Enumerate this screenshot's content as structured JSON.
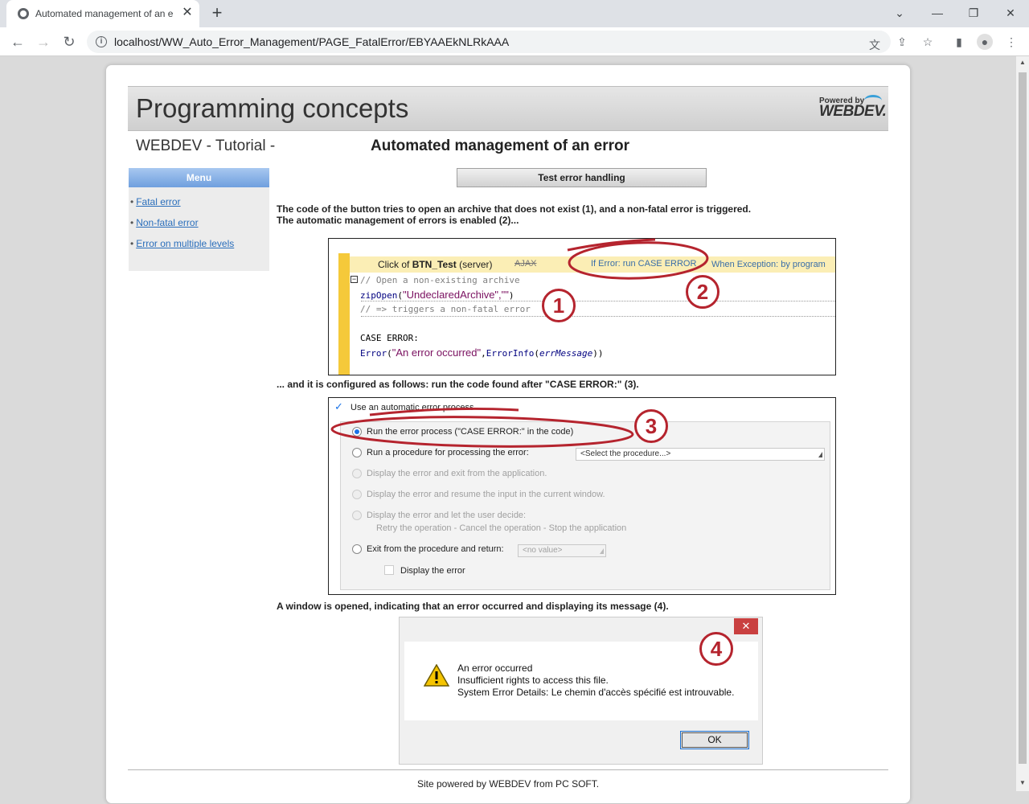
{
  "browser": {
    "tab_title": "Automated management of an e",
    "tab_close": "✕",
    "new_tab": "+",
    "url": "localhost/WW_Auto_Error_Management/PAGE_FatalError/EBYAAEkNLRkAAA",
    "win_controls": [
      "⌄",
      "—",
      "❐",
      "✕"
    ],
    "nav": {
      "back": "←",
      "forward": "→",
      "reload": "↻"
    },
    "toolbar_icons": [
      "translate-icon",
      "share-icon",
      "star-icon",
      "sidebar-icon",
      "profile-icon",
      "menu-icon"
    ]
  },
  "header": {
    "title": "Programming concepts",
    "logo_small": "Powered by",
    "logo_big": "WEBDEV."
  },
  "subtitle": "WEBDEV - Tutorial -",
  "heading": "Automated management of an error",
  "menu": {
    "title": "Menu",
    "items": [
      {
        "bullet": "•",
        "label": "Fatal error"
      },
      {
        "bullet": "•",
        "label": "Non-fatal error"
      },
      {
        "bullet": "•",
        "label": "Error on multiple levels"
      }
    ]
  },
  "test_button": "Test error handling",
  "paragraphs": {
    "p1_line1": "The code of the button tries to open an archive that does not exist (1), and a non-fatal error is triggered.",
    "p1_line2": "The automatic management of errors is enabled (2)...",
    "p2": "... and it is configured as follows: run the code found after \"CASE ERROR:\" (3).",
    "p3": "A window is opened, indicating that an error occurred and displaying its message (4)."
  },
  "code": {
    "click_prefix": "Click of ",
    "click_name": "BTN_Test",
    "click_suffix": " (server)",
    "ajax": "AJAX",
    "if_error": "If Error: run CASE ERROR",
    "when_exception": "When Exception: by program",
    "collapse": "−",
    "line_comment1": "// Open a non-existing archive",
    "line_fn": "zipOpen",
    "line_args_open": "(",
    "line_args_str": "\"UndeclaredArchive\",\"\"",
    "line_args_close": ")",
    "line_comment2": "// => triggers a non-fatal error",
    "line_case": "CASE ERROR:",
    "line_error_fn": "Error",
    "line_error_open": "(",
    "line_error_str": "\"An error occurred\"",
    "line_error_comma": ",",
    "line_errorinfo": "ErrorInfo",
    "line_errorinfo_open": "(",
    "line_errmsg": "errMessage",
    "line_close": "))"
  },
  "settings": {
    "use_auto": "Use an automatic error process",
    "run_process": "Run the error process (\"CASE ERROR:\" in the code)",
    "run_procedure": "Run a procedure for processing the error:",
    "select_procedure": "<Select the procedure...>",
    "display_exit": "Display the error and exit from the application.",
    "display_resume": "Display the error and resume the input in the current window.",
    "display_decide": "Display the error and let the user decide:",
    "decide_options": "Retry the operation - Cancel the operation - Stop the application",
    "exit_return": "Exit from the procedure and return:",
    "no_value": "<no value>",
    "display_error": "Display the error"
  },
  "dialog": {
    "close": "✕",
    "line1": "An error occurred",
    "line2": "Insufficient rights to access this file.",
    "line3": "System Error Details: Le chemin d'accès spécifié est introuvable.",
    "ok": "OK"
  },
  "callouts": [
    "1",
    "2",
    "3",
    "4"
  ],
  "footer": "Site powered by WEBDEV from PC SOFT.",
  "colors": {
    "annotation_red": "#b5242e",
    "menu_blue": "#6f9fde",
    "link_blue": "#2a6ebb",
    "gutter_yellow": "#f5c93a"
  }
}
